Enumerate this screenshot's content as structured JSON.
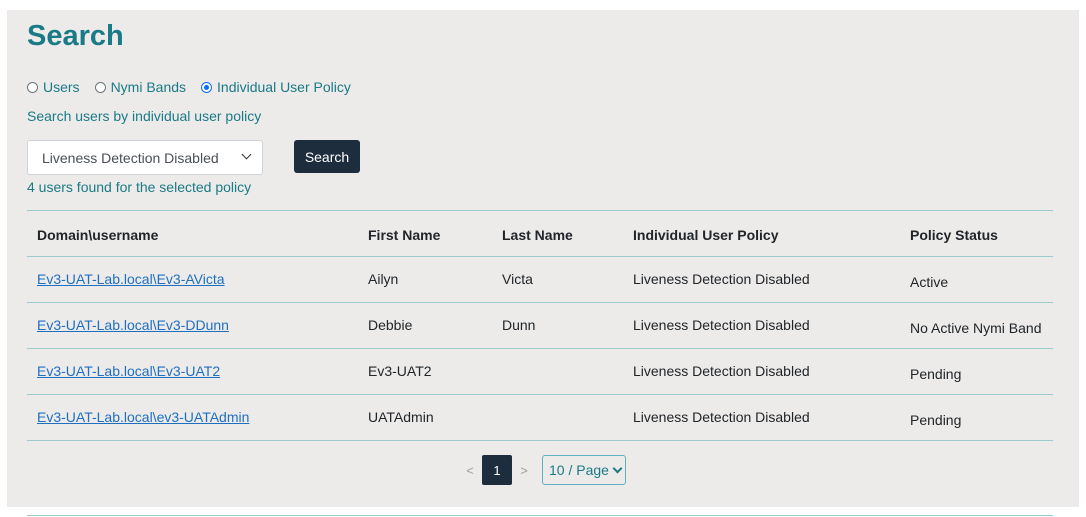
{
  "page": {
    "title": "Search"
  },
  "search_type": {
    "options": [
      {
        "label": "Users",
        "selected": false
      },
      {
        "label": "Nymi Bands",
        "selected": false
      },
      {
        "label": "Individual User Policy",
        "selected": true
      }
    ]
  },
  "subtitle": "Search users by individual user policy",
  "policy_select": {
    "value": "Liveness Detection Disabled"
  },
  "search_button": "Search",
  "result_count": "4 users found for the selected policy",
  "table": {
    "headers": [
      "Domain\\username",
      "First Name",
      "Last Name",
      "Individual User Policy",
      "Policy Status"
    ],
    "rows": [
      {
        "username": "Ev3-UAT-Lab.local\\Ev3-AVicta",
        "first": "Ailyn",
        "last": "Victa",
        "policy": "Liveness Detection Disabled",
        "status": "Active"
      },
      {
        "username": "Ev3-UAT-Lab.local\\Ev3-DDunn",
        "first": "Debbie",
        "last": "Dunn",
        "policy": "Liveness Detection Disabled",
        "status": "No Active Nymi Band"
      },
      {
        "username": "Ev3-UAT-Lab.local\\Ev3-UAT2",
        "first": "Ev3-UAT2",
        "last": "",
        "policy": "Liveness Detection Disabled",
        "status": "Pending"
      },
      {
        "username": "Ev3-UAT-Lab.local\\ev3-UATAdmin",
        "first": "UATAdmin",
        "last": "",
        "policy": "Liveness Detection Disabled",
        "status": "Pending"
      }
    ]
  },
  "pagination": {
    "prev": "<",
    "current_page": "1",
    "next": ">",
    "page_size": "10 / Page"
  },
  "colors": {
    "accent": "#1a7a86",
    "dark_button": "#1e2d3d",
    "link": "#1f6fc1",
    "panel_bg": "#ecebea"
  }
}
